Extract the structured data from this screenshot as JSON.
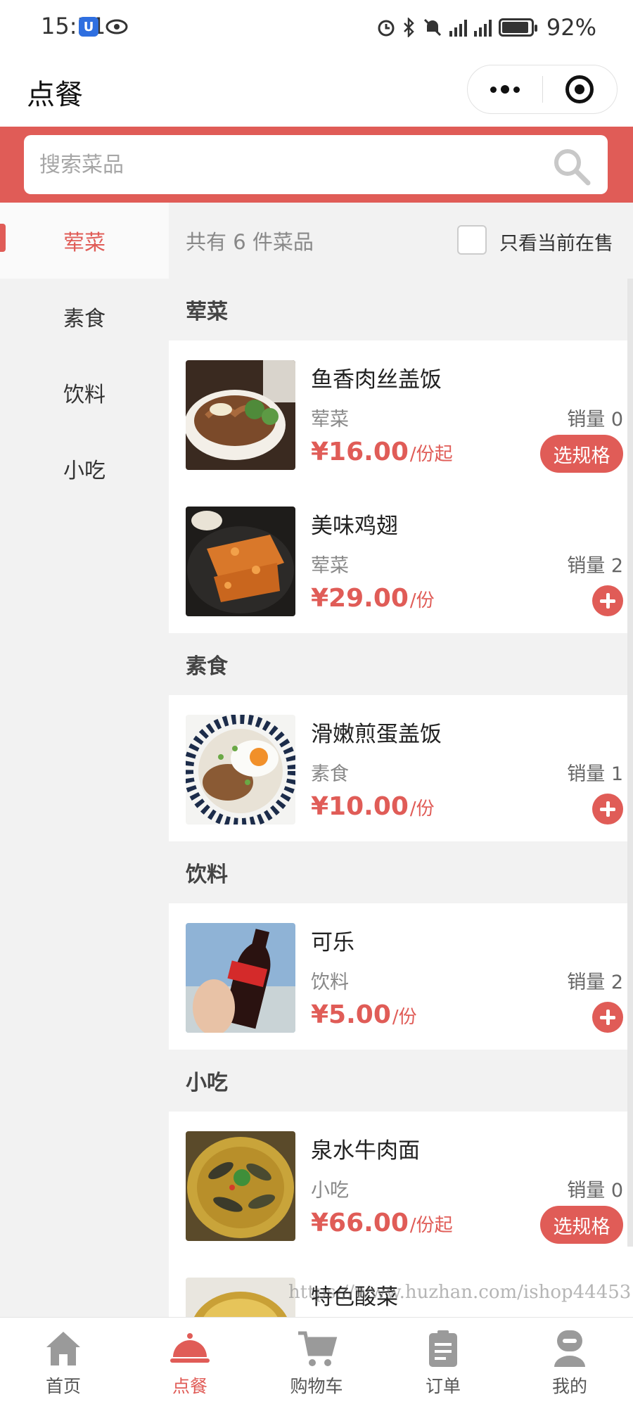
{
  "status_bar": {
    "time": "15:31",
    "battery": "92%",
    "network": "4G"
  },
  "nav": {
    "title": "点餐"
  },
  "search": {
    "placeholder": "搜索菜品"
  },
  "sidebar": {
    "items": [
      {
        "label": "荤菜",
        "active": true
      },
      {
        "label": "素食",
        "active": false
      },
      {
        "label": "饮料",
        "active": false
      },
      {
        "label": "小吃",
        "active": false
      }
    ]
  },
  "summary": {
    "count_text": "共有 6 件菜品",
    "onsale_label": "只看当前在售"
  },
  "sections": [
    {
      "title": "荤菜",
      "dishes": [
        {
          "name": "鱼香肉丝盖饭",
          "category": "荤菜",
          "sales": "销量 0",
          "price": "¥16.00",
          "unit": "/份起",
          "action": "选规格"
        },
        {
          "name": "美味鸡翅",
          "category": "荤菜",
          "sales": "销量 2",
          "price": "¥29.00",
          "unit": "/份",
          "action": "add"
        }
      ]
    },
    {
      "title": "素食",
      "dishes": [
        {
          "name": "滑嫩煎蛋盖饭",
          "category": "素食",
          "sales": "销量 1",
          "price": "¥10.00",
          "unit": "/份",
          "action": "add"
        }
      ]
    },
    {
      "title": "饮料",
      "dishes": [
        {
          "name": "可乐",
          "category": "饮料",
          "sales": "销量 2",
          "price": "¥5.00",
          "unit": "/份",
          "action": "add"
        }
      ]
    },
    {
      "title": "小吃",
      "dishes": [
        {
          "name": "泉水牛肉面",
          "category": "小吃",
          "sales": "销量 0",
          "price": "¥66.00",
          "unit": "/份起",
          "action": "选规格"
        },
        {
          "name": "特色酸菜",
          "category": "",
          "sales": "",
          "price": "",
          "unit": "",
          "action": ""
        }
      ]
    }
  ],
  "watermark": "https://www.huzhan.com/ishop44453",
  "tabbar": {
    "items": [
      {
        "label": "首页",
        "icon": "home-icon",
        "active": false
      },
      {
        "label": "点餐",
        "icon": "cloche-icon",
        "active": true
      },
      {
        "label": "购物车",
        "icon": "cart-icon",
        "active": false
      },
      {
        "label": "订单",
        "icon": "clipboard-icon",
        "active": false
      },
      {
        "label": "我的",
        "icon": "user-icon",
        "active": false
      }
    ]
  },
  "colors": {
    "accent": "#e05c57",
    "sidebar_bg": "#f2f2f2"
  }
}
